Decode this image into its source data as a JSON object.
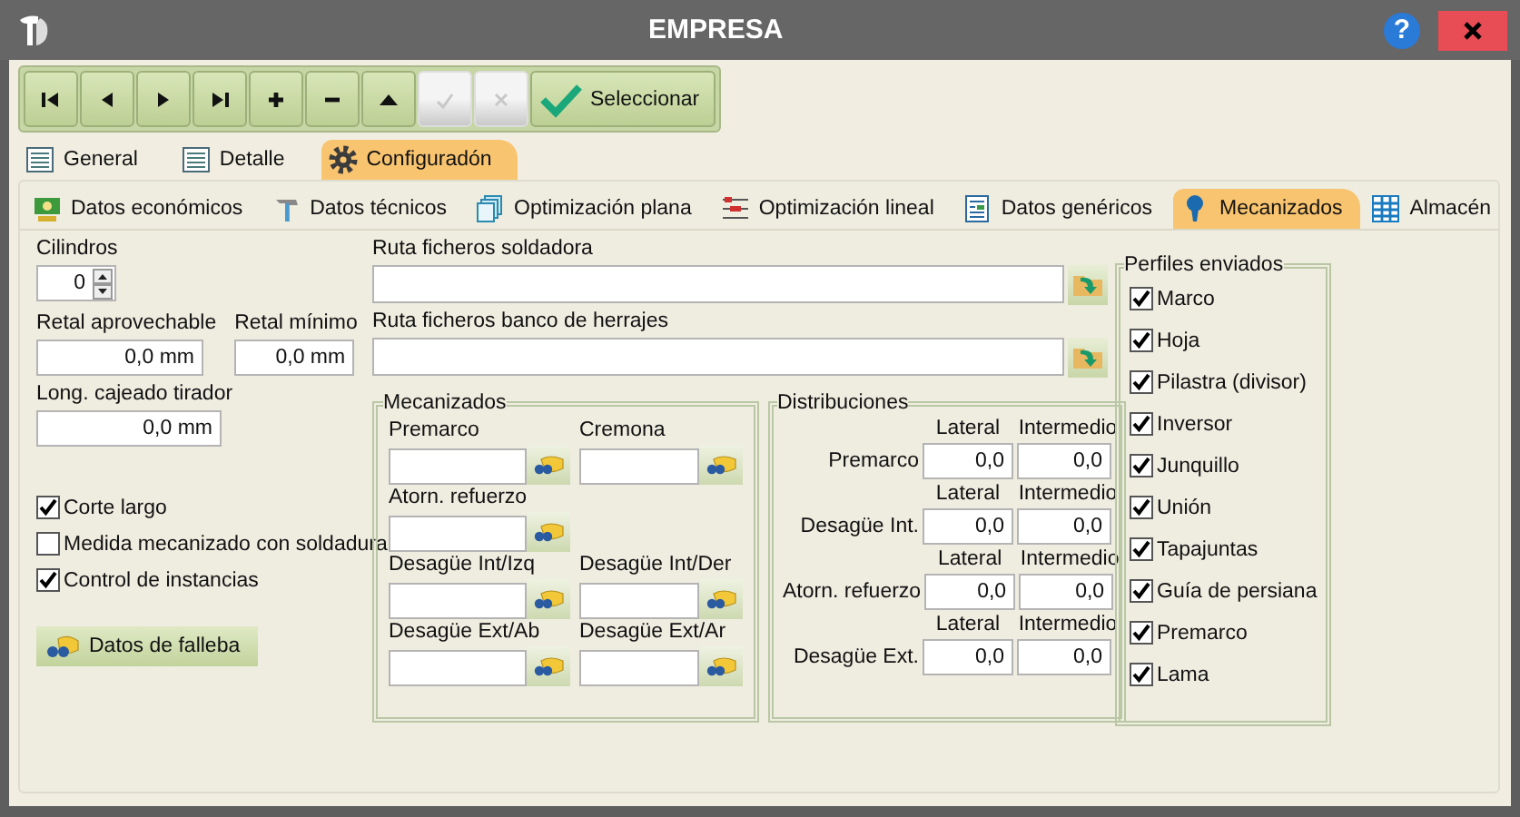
{
  "window": {
    "title": "EMPRESA",
    "help": "?"
  },
  "toolbar": {
    "buttons": [
      {
        "kind": "first",
        "disabled": false
      },
      {
        "kind": "prev",
        "disabled": false
      },
      {
        "kind": "next",
        "disabled": false
      },
      {
        "kind": "last",
        "disabled": false
      },
      {
        "kind": "add",
        "disabled": false
      },
      {
        "kind": "remove",
        "disabled": false
      },
      {
        "kind": "up",
        "disabled": false
      },
      {
        "kind": "accept",
        "disabled": true
      },
      {
        "kind": "cancel",
        "disabled": true
      }
    ],
    "select_label": "Seleccionar"
  },
  "tabs": [
    {
      "label": "General",
      "selected": false
    },
    {
      "label": "Detalle",
      "selected": false
    },
    {
      "label": "Configuradón",
      "selected": true
    }
  ],
  "subtabs": [
    {
      "label": "Datos económicos",
      "selected": false
    },
    {
      "label": "Datos técnicos",
      "selected": false
    },
    {
      "label": "Optimización plana",
      "selected": false
    },
    {
      "label": "Optimización lineal",
      "selected": false
    },
    {
      "label": "Datos genéricos",
      "selected": false
    },
    {
      "label": "Mecanizados",
      "selected": true
    },
    {
      "label": "Almacén",
      "selected": false
    }
  ],
  "cilindros": {
    "label": "Cilindros",
    "value": "0"
  },
  "retal_fields": [
    {
      "label": "Retal aprovechable",
      "value": "0,0 mm"
    },
    {
      "label": "Retal mínimo",
      "value": "0,0 mm"
    }
  ],
  "cajeado": {
    "label": "Long. cajeado tirador",
    "value": "0,0 mm"
  },
  "options": [
    {
      "label": "Corte largo",
      "checked": true
    },
    {
      "label": "Medida mecanizado con soldadura",
      "checked": false
    },
    {
      "label": "Control de instancias",
      "checked": true
    }
  ],
  "falleba_button": "Datos de falleba",
  "route_fields": [
    {
      "label": "Ruta ficheros soldadora"
    },
    {
      "label": "Ruta ficheros banco de herrajes"
    }
  ],
  "mecanizados": {
    "title": "Mecanizados",
    "rows": [
      [
        {
          "label": "Premarco"
        },
        {
          "label": "Cremona"
        }
      ],
      [
        {
          "label": "Atorn. refuerzo"
        }
      ],
      [
        {
          "label": "Desagüe Int/Izq"
        },
        {
          "label": "Desagüe Int/Der"
        }
      ],
      [
        {
          "label": "Desagüe Ext/Ab"
        },
        {
          "label": "Desagüe Ext/Ar"
        }
      ]
    ]
  },
  "distribuciones": {
    "title": "Distribuciones",
    "rows": [
      {
        "label": "Premarco",
        "head_a": "Lateral",
        "head_b": "Intermedio",
        "value_a": "0,0",
        "value_b": "0,0"
      },
      {
        "label": "Desagüe Int.",
        "head_a": "Lateral",
        "head_b": "Intermedio",
        "value_a": "0,0",
        "value_b": "0,0"
      },
      {
        "label": "Atorn. refuerzo",
        "head_a": "Lateral",
        "head_b": "Intermedio",
        "value_a": "0,0",
        "value_b": "0,0"
      },
      {
        "label": "Desagüe Ext.",
        "head_a": "Lateral",
        "head_b": "Intermedio",
        "value_a": "0,0",
        "value_b": "0,0"
      }
    ]
  },
  "perfiles": {
    "title": "Perfiles enviados",
    "items": [
      {
        "label": "Marco",
        "checked": true
      },
      {
        "label": "Hoja",
        "checked": true
      },
      {
        "label": "Pilastra (divisor)",
        "checked": true
      },
      {
        "label": "Inversor",
        "checked": true
      },
      {
        "label": "Junquillo",
        "checked": true
      },
      {
        "label": "Unión",
        "checked": true
      },
      {
        "label": "Tapajuntas",
        "checked": true
      },
      {
        "label": "Guía de persiana",
        "checked": true
      },
      {
        "label": "Premarco",
        "checked": true
      },
      {
        "label": "Lama",
        "checked": true
      }
    ]
  }
}
